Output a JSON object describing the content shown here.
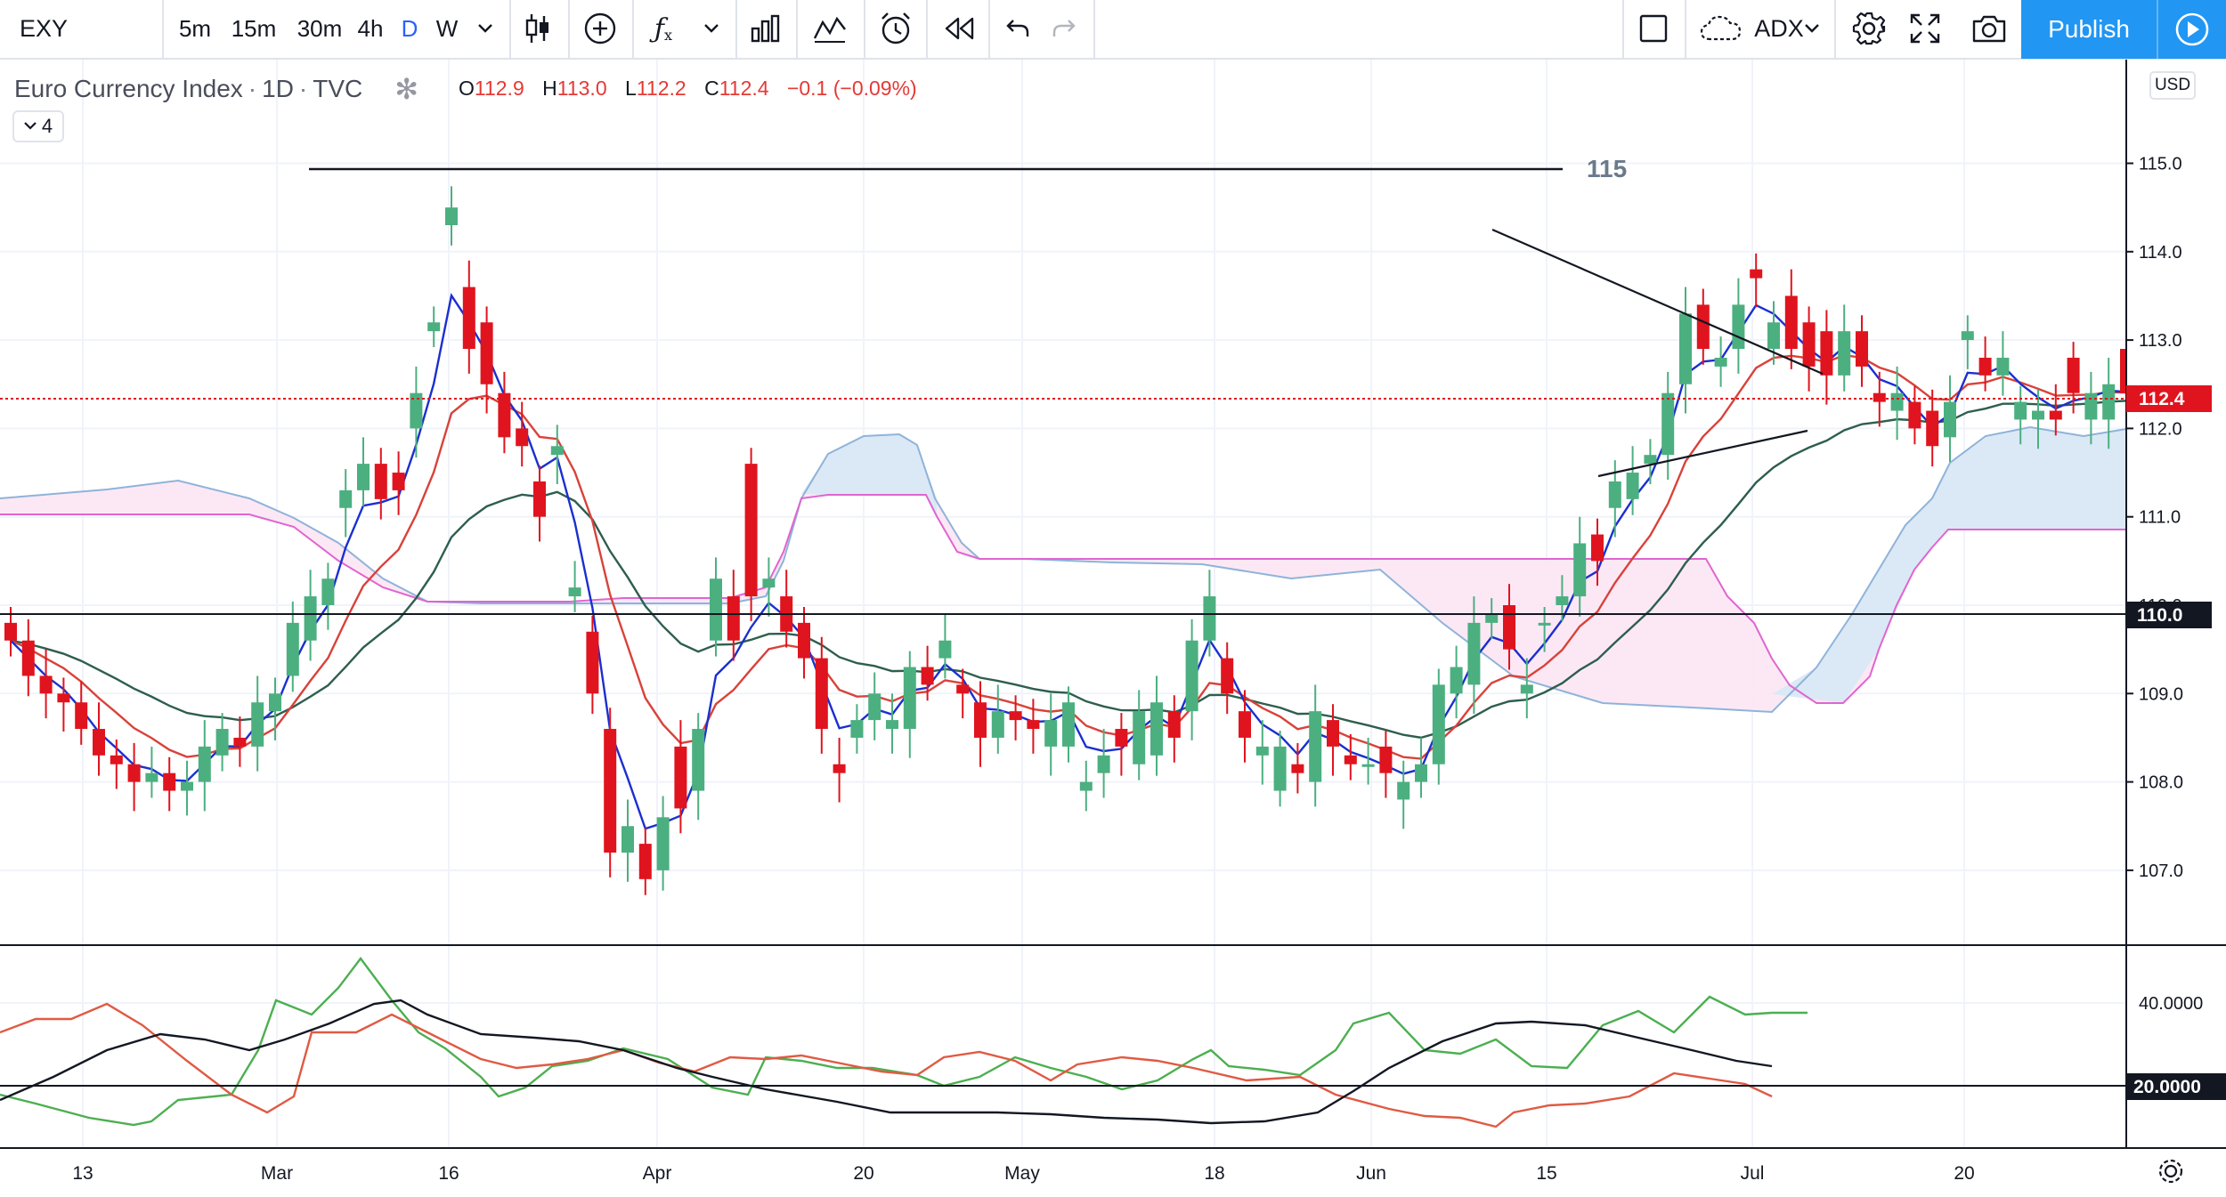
{
  "toolbar": {
    "symbol": "EXY",
    "intervals": [
      "5m",
      "15m",
      "30m",
      "4h",
      "D",
      "W"
    ],
    "active_interval": "D",
    "indicator_name": "ADX",
    "publish_label": "Publish"
  },
  "legend": {
    "name": "Euro Currency Index",
    "timeframe": "1D",
    "exchange": "TVC",
    "o_label": "O",
    "o": "112.9",
    "h_label": "H",
    "h": "113.0",
    "l_label": "L",
    "l": "112.2",
    "c_label": "C",
    "c": "112.4",
    "change": "−0.1 (−0.09%)",
    "collapse_count": "4"
  },
  "currency": "USD",
  "colors": {
    "up": "#4caf80",
    "down": "#e0141e",
    "accent": "#2196f3"
  },
  "chart_data": {
    "type": "candlestick",
    "price_axis": {
      "ticks": [
        "107.0",
        "108.0",
        "109.0",
        "110.0",
        "111.0",
        "112.0",
        "113.0",
        "114.0",
        "115.0"
      ],
      "range": [
        106.2,
        115.9
      ]
    },
    "time_axis": {
      "labels": [
        "13",
        "Mar",
        "16",
        "Apr",
        "20",
        "May",
        "18",
        "Jun",
        "15",
        "Jul",
        "20"
      ]
    },
    "last_price": "112.4",
    "horizontal_line_label": "115",
    "level_110": "110.0",
    "candles": [
      [
        109.8,
        109.6
      ],
      [
        109.6,
        109.2
      ],
      [
        109.2,
        109.0
      ],
      [
        109.0,
        108.9
      ],
      [
        108.9,
        108.6
      ],
      [
        108.6,
        108.3
      ],
      [
        108.3,
        108.2
      ],
      [
        108.2,
        108.0
      ],
      [
        108.0,
        108.1
      ],
      [
        108.1,
        107.9
      ],
      [
        107.9,
        108.0
      ],
      [
        108.0,
        108.4
      ],
      [
        108.3,
        108.6
      ],
      [
        108.5,
        108.4
      ],
      [
        108.4,
        108.9
      ],
      [
        108.8,
        109.0
      ],
      [
        109.2,
        109.8
      ],
      [
        109.6,
        110.1
      ],
      [
        110.0,
        110.3
      ],
      [
        111.1,
        111.3
      ],
      [
        111.3,
        111.6
      ],
      [
        111.6,
        111.2
      ],
      [
        111.5,
        111.3
      ],
      [
        112.0,
        112.4
      ],
      [
        113.1,
        113.2
      ],
      [
        114.3,
        114.5
      ],
      [
        113.6,
        112.9
      ],
      [
        113.2,
        112.5
      ],
      [
        112.4,
        111.9
      ],
      [
        112.0,
        111.8
      ],
      [
        111.4,
        111.0
      ],
      [
        111.7,
        111.8
      ],
      [
        110.1,
        110.2
      ],
      [
        109.7,
        109.0
      ],
      [
        108.6,
        107.2
      ],
      [
        107.2,
        107.5
      ],
      [
        107.3,
        106.9
      ],
      [
        107.0,
        107.6
      ],
      [
        108.4,
        107.7
      ],
      [
        107.9,
        108.6
      ],
      [
        109.6,
        110.3
      ],
      [
        110.1,
        109.6
      ],
      [
        111.6,
        110.1
      ],
      [
        110.2,
        110.3
      ],
      [
        110.1,
        109.7
      ],
      [
        109.8,
        109.4
      ],
      [
        109.4,
        108.6
      ],
      [
        108.2,
        108.1
      ],
      [
        108.5,
        108.7
      ],
      [
        108.7,
        109.0
      ],
      [
        108.6,
        108.7
      ],
      [
        108.6,
        109.3
      ],
      [
        109.3,
        109.1
      ],
      [
        109.4,
        109.6
      ],
      [
        109.1,
        109.0
      ],
      [
        108.9,
        108.5
      ],
      [
        108.5,
        108.8
      ],
      [
        108.8,
        108.7
      ],
      [
        108.7,
        108.6
      ],
      [
        108.4,
        108.7
      ],
      [
        108.4,
        108.9
      ],
      [
        107.9,
        108.0
      ],
      [
        108.1,
        108.3
      ],
      [
        108.6,
        108.4
      ],
      [
        108.2,
        108.8
      ],
      [
        108.3,
        108.9
      ],
      [
        108.8,
        108.5
      ],
      [
        108.8,
        109.6
      ],
      [
        109.6,
        110.1
      ],
      [
        109.4,
        109.0
      ],
      [
        108.8,
        108.5
      ],
      [
        108.3,
        108.4
      ],
      [
        107.9,
        108.4
      ],
      [
        108.2,
        108.1
      ],
      [
        108.0,
        108.8
      ],
      [
        108.7,
        108.4
      ],
      [
        108.3,
        108.2
      ],
      [
        108.2,
        108.2
      ],
      [
        108.4,
        108.1
      ],
      [
        107.8,
        108.0
      ],
      [
        108.0,
        108.2
      ],
      [
        108.2,
        109.1
      ],
      [
        109.0,
        109.3
      ],
      [
        109.1,
        109.8
      ],
      [
        109.8,
        109.9
      ],
      [
        110.0,
        109.5
      ],
      [
        109.0,
        109.1
      ],
      [
        109.8,
        109.8
      ],
      [
        110.0,
        110.1
      ],
      [
        110.1,
        110.7
      ],
      [
        110.8,
        110.5
      ],
      [
        111.1,
        111.4
      ],
      [
        111.2,
        111.5
      ],
      [
        111.6,
        111.7
      ],
      [
        111.7,
        112.4
      ],
      [
        112.5,
        113.3
      ],
      [
        113.4,
        112.9
      ],
      [
        112.7,
        112.8
      ],
      [
        112.9,
        113.4
      ],
      [
        113.8,
        113.7
      ],
      [
        112.9,
        113.2
      ],
      [
        113.5,
        112.9
      ],
      [
        113.2,
        112.7
      ],
      [
        113.1,
        112.6
      ],
      [
        112.6,
        113.1
      ],
      [
        113.1,
        112.7
      ],
      [
        112.4,
        112.3
      ],
      [
        112.2,
        112.4
      ],
      [
        112.3,
        112.0
      ],
      [
        112.2,
        111.8
      ],
      [
        111.9,
        112.3
      ],
      [
        113.0,
        113.1
      ],
      [
        112.8,
        112.6
      ],
      [
        112.6,
        112.8
      ],
      [
        112.1,
        112.3
      ],
      [
        112.1,
        112.2
      ],
      [
        112.2,
        112.1
      ],
      [
        112.8,
        112.4
      ],
      [
        112.1,
        112.4
      ],
      [
        112.1,
        112.5
      ],
      [
        112.9,
        112.4
      ]
    ],
    "adx_ticks": [
      "20.0000",
      "40.0000"
    ]
  }
}
